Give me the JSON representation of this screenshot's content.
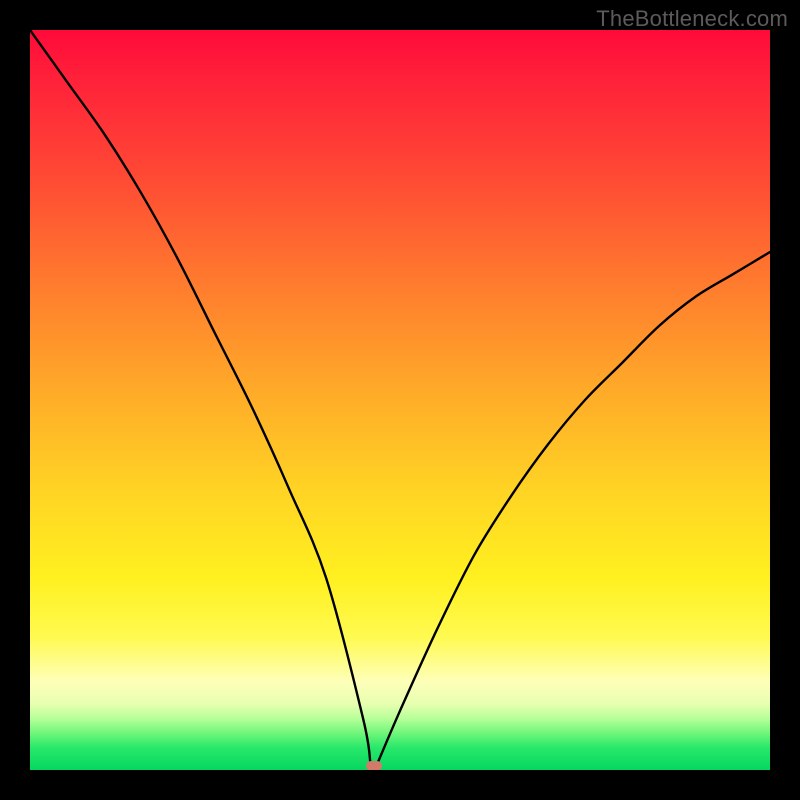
{
  "watermark": "TheBottleneck.com",
  "colors": {
    "frame": "#000000",
    "curve": "#000000",
    "marker": "#d47a6a",
    "gradient_top": "#ff0a3a",
    "gradient_mid": "#ffd324",
    "gradient_bottom": "#05d760"
  },
  "chart_data": {
    "type": "line",
    "title": "",
    "xlabel": "",
    "ylabel": "",
    "xlim": [
      0,
      100
    ],
    "ylim": [
      0,
      100
    ],
    "grid": false,
    "legend": false,
    "series": [
      {
        "name": "bottleneck-curve",
        "x": [
          0,
          5,
          10,
          15,
          20,
          25,
          30,
          35,
          40,
          45,
          46,
          47,
          50,
          55,
          60,
          65,
          70,
          75,
          80,
          85,
          90,
          95,
          100
        ],
        "y": [
          100,
          93,
          86,
          78,
          69,
          59,
          49,
          38,
          26,
          7,
          1,
          1,
          8,
          19,
          29,
          37,
          44,
          50,
          55,
          60,
          64,
          67,
          70
        ]
      }
    ],
    "minimum_marker": {
      "x": 46.5,
      "y": 0.5,
      "width_pct": 2.2,
      "height_pct": 1.4
    },
    "background": {
      "type": "vertical-gradient",
      "description": "red → orange → yellow → pale → green (bottleneck heatmap)"
    }
  }
}
